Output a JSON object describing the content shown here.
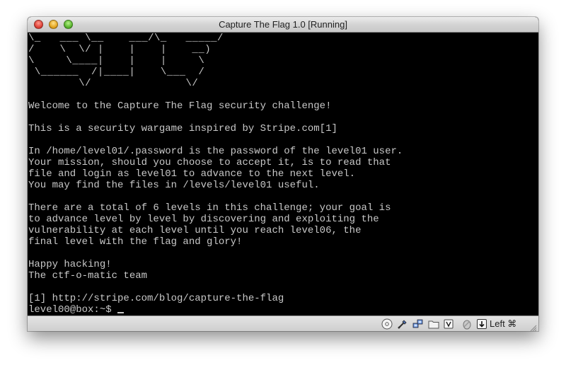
{
  "window": {
    "title": "Capture The Flag 1.0 [Running]"
  },
  "console": {
    "logo_lines": [
      "\\_   ___ \\__    ___/\\_   _____/",
      "/    \\  \\/ |    |    |    __)  ",
      "\\     \\____|    |    |     \\   ",
      " \\______  /|____|    \\___  /   ",
      "        \\/               \\/    "
    ],
    "text_lines": [
      "",
      "Welcome to the Capture The Flag security challenge!",
      "",
      "This is a security wargame inspired by Stripe.com[1]",
      "",
      "In /home/level01/.password is the password of the level01 user.",
      "Your mission, should you choose to accept it, is to read that",
      "file and login as level01 to advance to the next level.",
      "You may find the files in /levels/level01 useful.",
      "",
      "There are a total of 6 levels in this challenge; your goal is",
      "to advance level by level by discovering and exploiting the",
      "vulnerability at each level until you reach level06, the",
      "final level with the flag and glory!",
      "",
      "Happy hacking!",
      "The ctf-o-matic team",
      "",
      "[1] http://stripe.com/blog/capture-the-flag"
    ],
    "prompt": "level00@box:~$ "
  },
  "statusbar": {
    "icons": [
      "optical-drive-icon",
      "usb-icon",
      "network-icon",
      "shared-folder-icon",
      "display-icon",
      "mouse-integration-icon",
      "keyboard-capture-icon"
    ],
    "host_key": "Left ⌘"
  },
  "colors": {
    "console_bg": "#000000",
    "console_fg": "#c8c8c8",
    "titlebar": "#d4d4d4"
  }
}
